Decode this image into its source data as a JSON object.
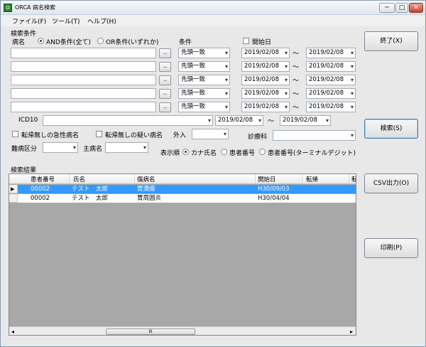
{
  "window": {
    "title": "ORCA 病名検索",
    "min": "─",
    "max": "□",
    "close": "✕"
  },
  "menu": {
    "file": "ファイル(F)",
    "tools": "ツール(T)",
    "help": "ヘルプ(H)"
  },
  "search": {
    "section_label": "検索条件",
    "byomei_label": "病名",
    "and_label": "AND条件(全て)",
    "or_label": "OR条件(いずれか)",
    "cond_header": "条件",
    "startdate_label": "開始日",
    "ellipsis": "..",
    "rows": [
      {
        "cond": "先頭一致",
        "from": "2019/02/08",
        "to": "2019/02/08"
      },
      {
        "cond": "先頭一致",
        "from": "2019/02/08",
        "to": "2019/02/08"
      },
      {
        "cond": "先頭一致",
        "from": "2019/02/08",
        "to": "2019/02/08"
      },
      {
        "cond": "先頭一致",
        "from": "2019/02/08",
        "to": "2019/02/08"
      },
      {
        "cond": "先頭一致",
        "from": "2019/02/08",
        "to": "2019/02/08"
      }
    ],
    "tilde": "〜",
    "icd10_label": "ICD10",
    "icd10_from": "2019/02/08",
    "icd10_to": "2019/02/08",
    "acute_label": "転帰無しの急性病名",
    "suspect_label": "転帰無しの疑い病名",
    "outpatient_label": "外入",
    "dept_label": "診療科",
    "nanbyo_label": "難病区分",
    "shubyo_label": "主病名",
    "order_label": "表示順",
    "order_kana": "カナ氏名",
    "order_pid": "患者番号",
    "order_pid_term": "患者番号(ターミナルデジット)"
  },
  "buttons": {
    "exit": "終了(X)",
    "search": "検索(S)",
    "csv": "CSV出力(O)",
    "print": "印刷(P)"
  },
  "results": {
    "section_label": "検索結果",
    "columns": [
      "患者番号",
      "氏名",
      "傷病名",
      "開始日",
      "転帰",
      "転"
    ],
    "rows": [
      [
        "00002",
        "テスト　太郎",
        "胃潰瘍",
        "H30/09/03",
        ""
      ],
      [
        "00002",
        "テスト　太郎",
        "胃周囲炎",
        "H30/04/04",
        ""
      ]
    ],
    "scroll_mark": "III"
  },
  "colors": {
    "selected_row": "#3399ff",
    "grid_bg": "#a8a8a8"
  }
}
